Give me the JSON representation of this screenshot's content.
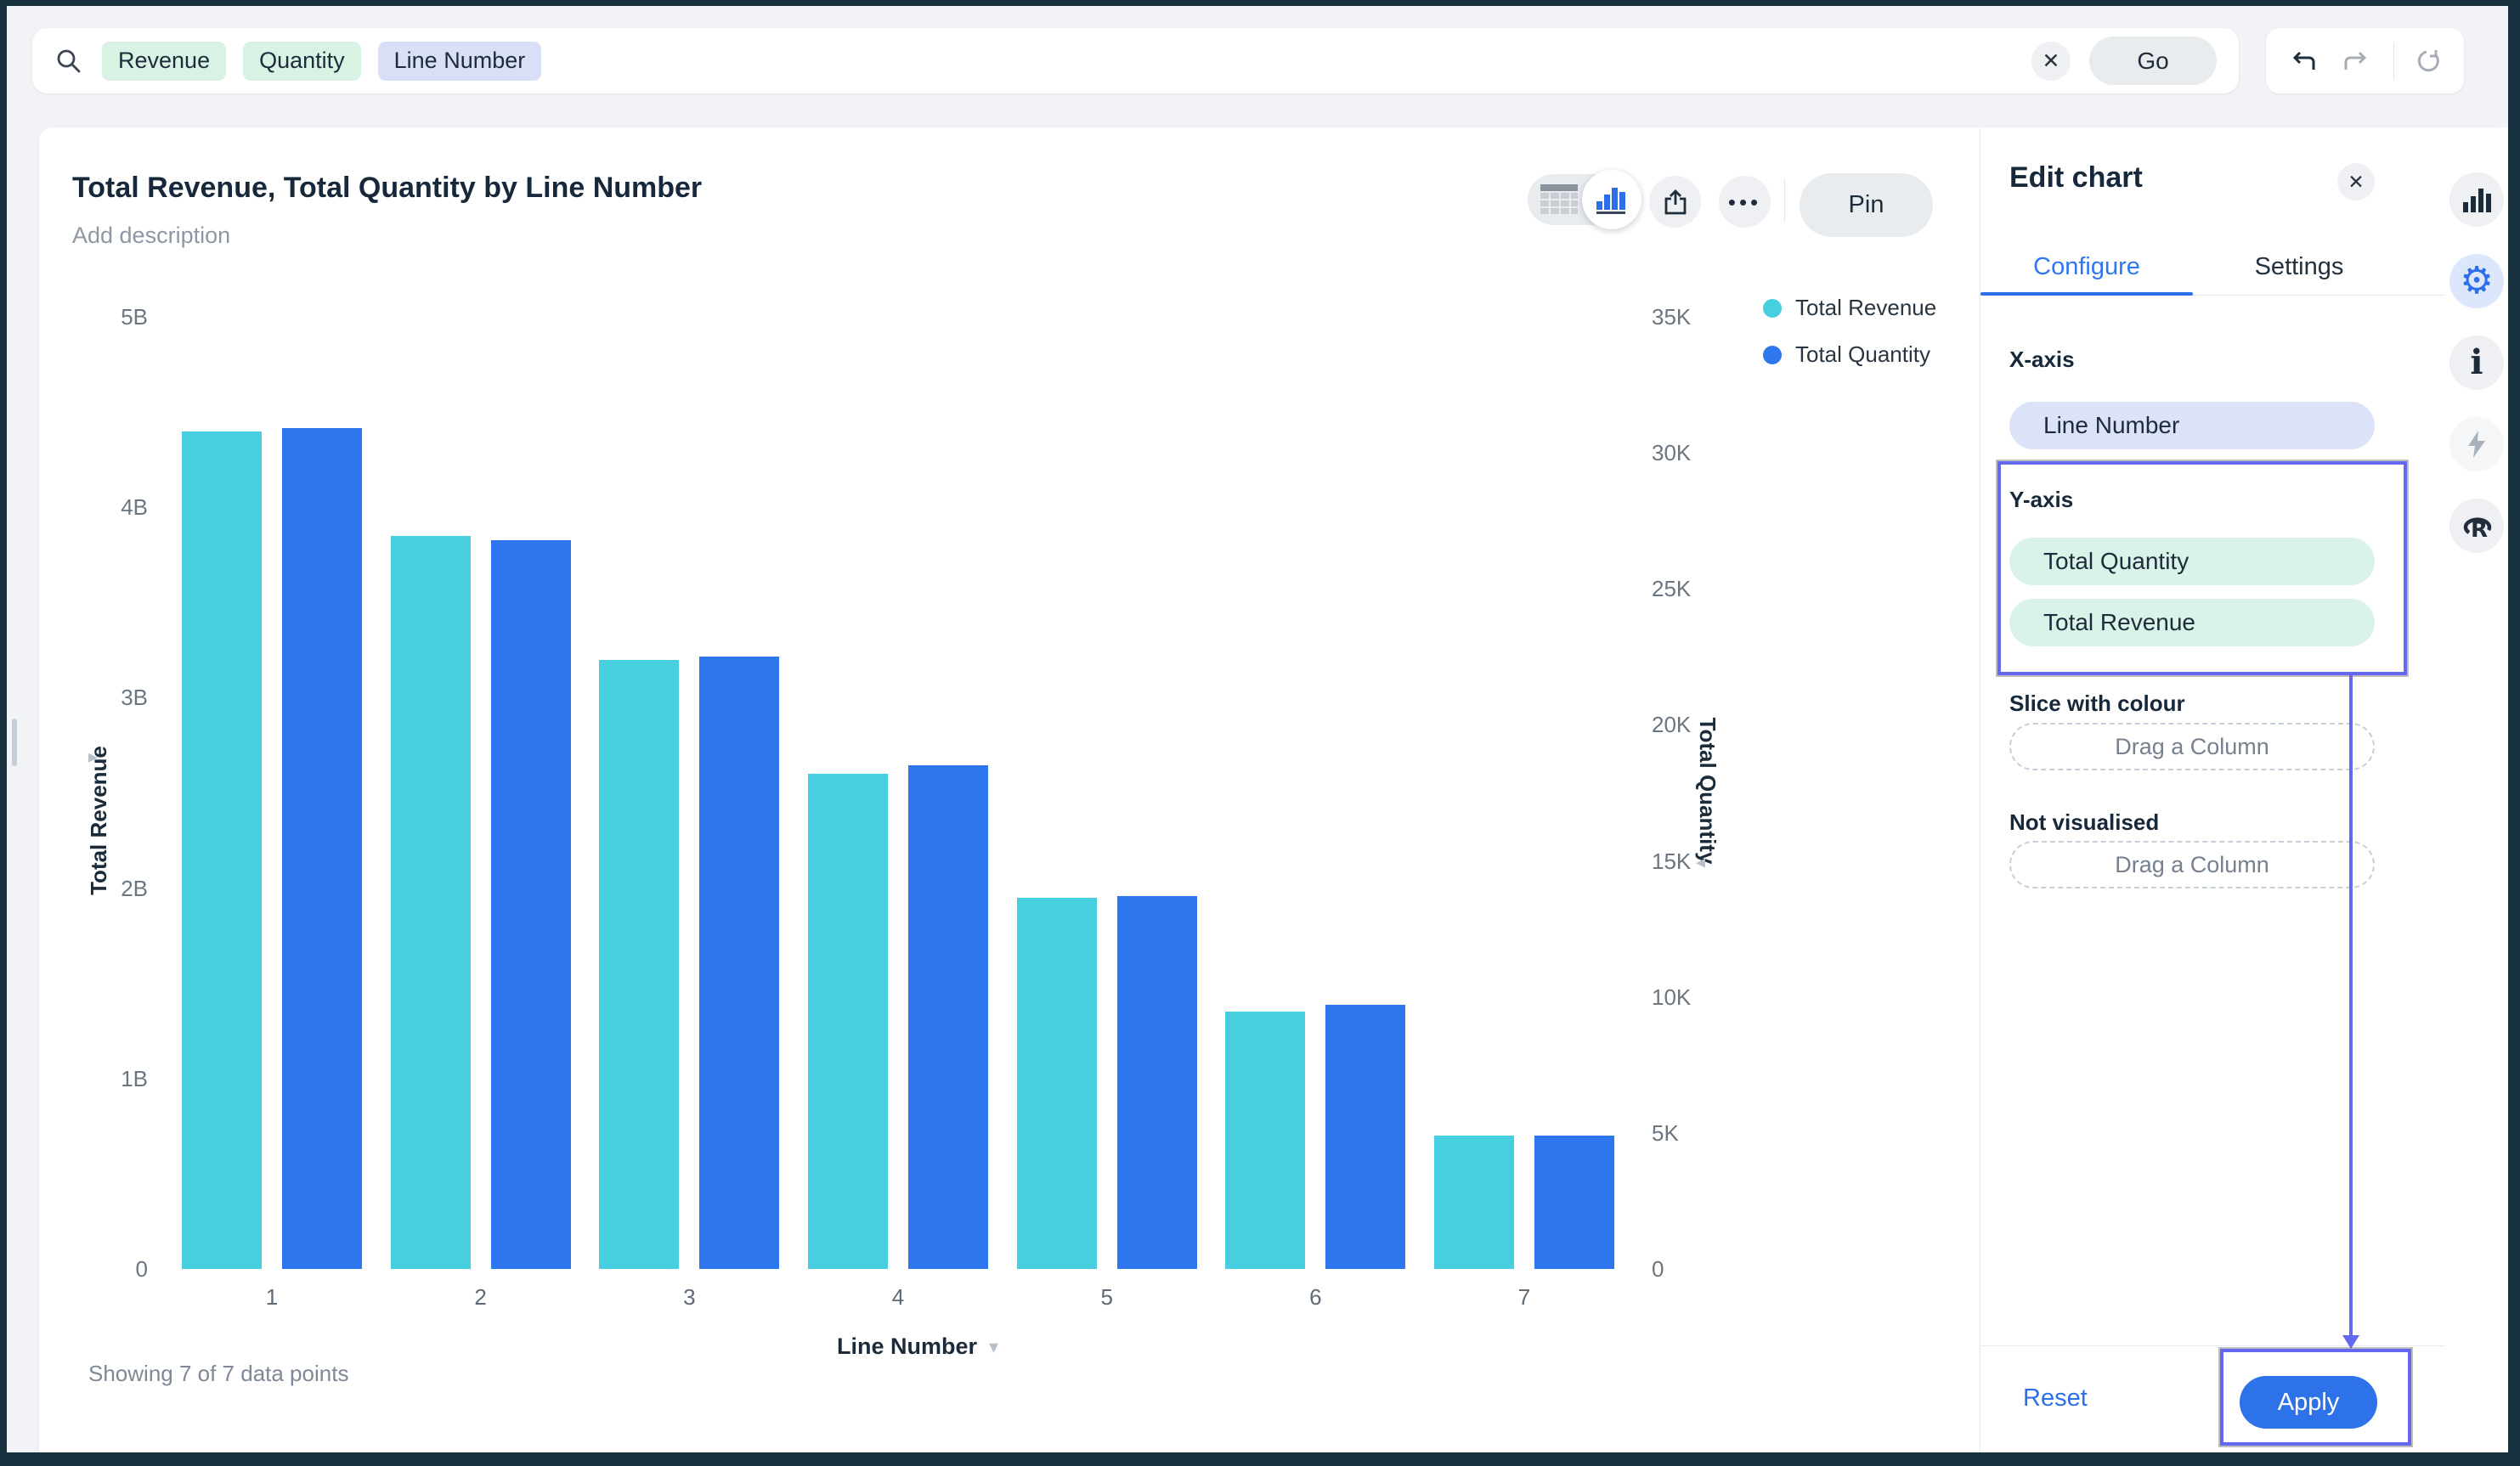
{
  "topbar": {
    "search": {
      "chips": [
        {
          "label": "Revenue",
          "bg": "#d8f2e4"
        },
        {
          "label": "Quantity",
          "bg": "#d8f2e4"
        },
        {
          "label": "Line Number",
          "bg": "#d9dff7"
        }
      ],
      "clear_label": "✕",
      "go_label": "Go"
    }
  },
  "chart": {
    "title": "Total Revenue, Total Quantity by Line Number",
    "description_placeholder": "Add description",
    "toolbar": {
      "pin_label": "Pin"
    },
    "footnote": "Showing 7 of 7 data points"
  },
  "chart_data": {
    "type": "bar",
    "title": "Total Revenue, Total Quantity by Line Number",
    "categories": [
      "1",
      "2",
      "3",
      "4",
      "5",
      "6",
      "7"
    ],
    "xlabel": "Line Number",
    "series": [
      {
        "name": "Total Revenue",
        "axis": "left",
        "color": "#47cfdf",
        "unit": "billions",
        "values": [
          4.4,
          3.85,
          3.2,
          2.6,
          1.95,
          1.35,
          0.7
        ]
      },
      {
        "name": "Total Quantity",
        "axis": "right",
        "color": "#2e76ee",
        "unit": "thousands",
        "values": [
          30.9,
          26.8,
          22.5,
          18.5,
          13.7,
          9.7,
          4.9
        ]
      }
    ],
    "left_axis": {
      "label": "Total Revenue",
      "ticks": [
        "5B",
        "4B",
        "3B",
        "2B",
        "1B",
        "0"
      ],
      "max_value": 5,
      "unit": "B"
    },
    "right_axis": {
      "label": "Total Quantity",
      "ticks": [
        "35K",
        "30K",
        "25K",
        "20K",
        "15K",
        "10K",
        "5K",
        "0"
      ],
      "max_value": 35,
      "unit": "K"
    },
    "legend": [
      {
        "label": "Total Revenue",
        "color": "#47cfdf"
      },
      {
        "label": "Total Quantity",
        "color": "#2e76ee"
      }
    ],
    "legend_position": "top-right",
    "grid": false,
    "footnote": "Showing 7 of 7 data points"
  },
  "edit_panel": {
    "title": "Edit chart",
    "close_label": "✕",
    "tabs": [
      {
        "label": "Configure",
        "active": true
      },
      {
        "label": "Settings",
        "active": false
      }
    ],
    "sections": {
      "x_axis": {
        "label": "X-axis",
        "pills": [
          {
            "label": "Line Number",
            "bg": "#dce3f8"
          }
        ]
      },
      "y_axis": {
        "label": "Y-axis",
        "pills": [
          {
            "label": "Total Quantity",
            "bg": "#d9f3e8"
          },
          {
            "label": "Total Revenue",
            "bg": "#d9f3e8"
          }
        ]
      },
      "slice": {
        "label": "Slice with colour",
        "placeholder": "Drag a Column"
      },
      "not_visualised": {
        "label": "Not visualised",
        "placeholder": "Drag a Column"
      }
    },
    "footer": {
      "reset_label": "Reset",
      "apply_label": "Apply"
    },
    "annotation_color": "#6468ee"
  },
  "icons": {
    "topbar": [
      "magnifier-icon",
      "close-icon",
      "undo-arrow-icon",
      "redo-arrow-icon",
      "refresh-icon"
    ],
    "chart_toolbar": [
      "table-view-icon",
      "bar-chart-view-icon",
      "share-export-icon",
      "ellipsis-icon"
    ],
    "sort_indicators": [
      "triangle-right-icon",
      "triangle-left-icon",
      "triangle-down-icon"
    ],
    "sidebar": [
      "bar-chart-icon",
      "gear-icon",
      "info-icon",
      "lightning-icon",
      "r-logo-icon"
    ]
  },
  "colors": {
    "accent_blue": "#2d6fe8",
    "bar_cyan": "#47cfdf",
    "bar_blue": "#2e76ee",
    "annotation_purple": "#6468ee",
    "chip_mint": "#d8f2e4",
    "chip_lavender": "#d9dff7",
    "background": "#f1f3f6",
    "frame": "#16313d"
  }
}
